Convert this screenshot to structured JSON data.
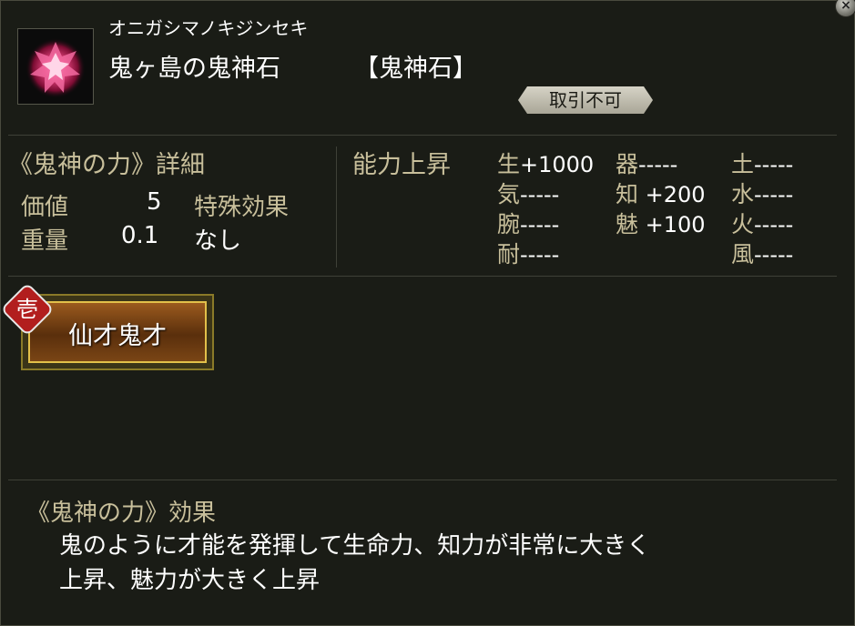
{
  "header": {
    "reading": "オニガシマノキジンセキ",
    "name": "鬼ヶ島の鬼神石",
    "category": "【鬼神石】",
    "trade_status": "取引不可",
    "close_glyph": "×",
    "icon": "red-gem-icon"
  },
  "details": {
    "title": "《鬼神の力》詳細",
    "value_label": "価値",
    "value": "5",
    "weight_label": "重量",
    "weight": "0.1",
    "special_label": "特殊効果",
    "special_value": "なし"
  },
  "ability": {
    "title": "能力上昇",
    "items": [
      {
        "label": "生",
        "value": "+1000"
      },
      {
        "label": "気",
        "value": "-----"
      },
      {
        "label": "腕",
        "value": "-----"
      },
      {
        "label": "耐",
        "value": "-----"
      },
      {
        "label": "器",
        "value": "-----"
      },
      {
        "label": "知",
        "value": " +200"
      },
      {
        "label": "魅",
        "value": " +100"
      },
      {
        "label": "土",
        "value": "-----"
      },
      {
        "label": "水",
        "value": "-----"
      },
      {
        "label": "火",
        "value": "-----"
      },
      {
        "label": "風",
        "value": "-----"
      }
    ]
  },
  "skill": {
    "rank": "壱",
    "label": "仙才鬼才"
  },
  "effect": {
    "title": "《鬼神の力》効果",
    "lines": [
      "鬼のように才能を発揮して生命力、知力が非常に大きく",
      "上昇、魅力が大きく上昇"
    ]
  },
  "colors": {
    "background": "#1a1c16",
    "label": "#c8bf9b",
    "value": "#ffffff",
    "gem": "#e0407a",
    "rank_badge": "#b21e1e"
  }
}
